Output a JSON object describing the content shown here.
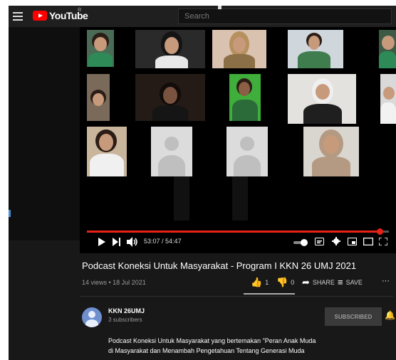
{
  "header": {
    "logo_text": "YouTube",
    "logo_sup": "®",
    "search_placeholder": "Search"
  },
  "player": {
    "current_time": "53:07",
    "duration": "54:47",
    "progress": 0.97,
    "accent_color": "#e62117"
  },
  "video": {
    "title": "Podcast Koneksi Untuk Masyarakat - Program I KKN 26 UMJ 2021",
    "meta": "14 views • 18 Jul 2021",
    "likes": "1",
    "dislikes": "0",
    "share_label": "SHARE",
    "save_label": "SAVE",
    "more_label": "···"
  },
  "channel": {
    "name": "KKN 26UMJ",
    "subscribers": "3 subscribers",
    "subscribe_label": "SUBSCRIBED"
  },
  "description": {
    "line1": "Podcast Koneksi Untuk Masyarakat yang bertemakan \"Peran Anak Muda",
    "line2": "di Masyarakat dan Menambah Pengetahuan Tentang Generasi Muda"
  },
  "icons": {
    "menu": "menu-icon",
    "play": "play-icon",
    "next": "next-icon",
    "volume": "volume-icon",
    "autoplay": "autoplay-toggle",
    "captions": "captions-icon",
    "settings": "gear-icon",
    "miniplayer": "miniplayer-icon",
    "theater": "theater-icon",
    "fullscreen": "fullscreen-icon",
    "like": "thumbs-up-icon",
    "dislike": "thumbs-down-icon",
    "share": "share-icon",
    "save": "save-icon",
    "bell": "bell-icon"
  }
}
